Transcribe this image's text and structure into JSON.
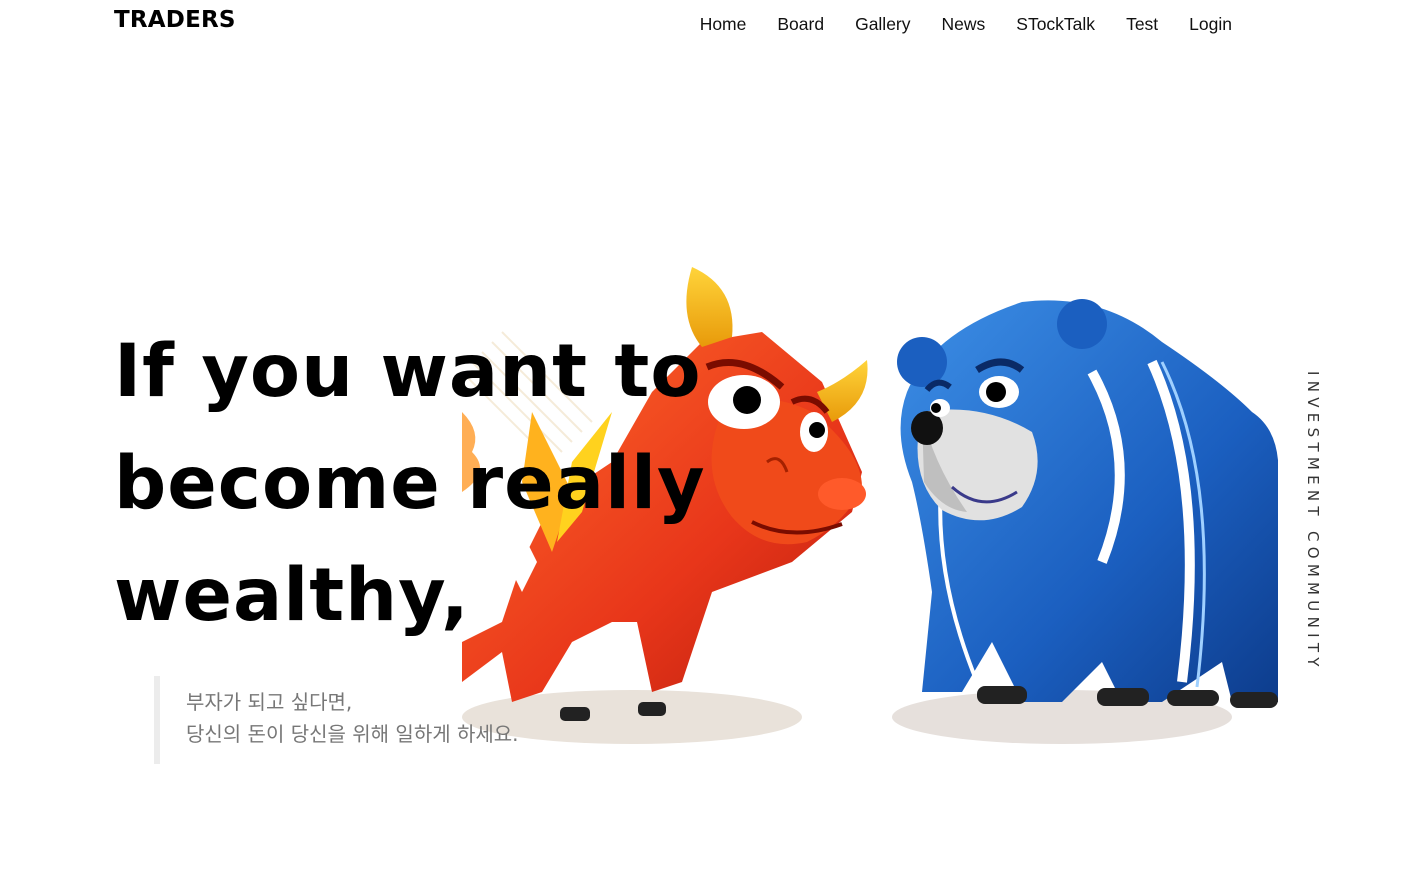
{
  "brand": {
    "logo": "TRADERS"
  },
  "nav": {
    "items": [
      "Home",
      "Board",
      "Gallery",
      "News",
      "STockTalk",
      "Test",
      "Login"
    ]
  },
  "hero": {
    "headline_lines": [
      "If you want to",
      "become really",
      "wealthy,"
    ],
    "quote_lines": [
      "부자가 되고 싶다면,",
      "당신의 돈이 당신을 위해 일하게 하세요."
    ],
    "side_label": "INVESTMENT COMMUNITY",
    "art": {
      "bull_icon": "bull-icon",
      "bear_icon": "bear-icon",
      "colors": {
        "bull": "#e8361a",
        "bull_horn": "#f3b90e",
        "bear": "#1b5fc0",
        "bear_stripe": "#ffffff"
      }
    }
  }
}
